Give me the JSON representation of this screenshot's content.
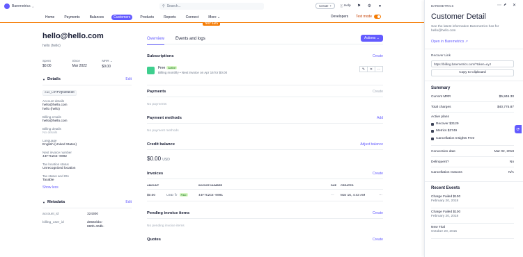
{
  "topbar": {
    "brand": "Baremetrics",
    "search_placeholder": "Search...",
    "create_label": "Create",
    "help_label": "Help"
  },
  "nav": {
    "items": [
      "Home",
      "Payments",
      "Balances",
      "Customers",
      "Products",
      "Reports",
      "Connect",
      "More"
    ],
    "active": "Customers",
    "developers": "Developers",
    "test_mode": "Test mode",
    "test_data_label": "TEST DATA"
  },
  "customer": {
    "email": "hello@hello.com",
    "subtitle": "hello (hello)",
    "stats": [
      {
        "label": "Spent",
        "value": "$0.00"
      },
      {
        "label": "Since",
        "value": "Mar 2022"
      },
      {
        "label": "MRR",
        "value": "$0.00"
      }
    ],
    "details": {
      "title": "Details",
      "edit": "Edit",
      "id": "cus_LKYFYQ5UKNKUD",
      "fields": [
        {
          "label": "Account details",
          "value": "hello@hello.com\nhello (hello)"
        },
        {
          "label": "Billing emails",
          "value": "hello@hello.com"
        },
        {
          "label": "Billing details",
          "value": "No details"
        },
        {
          "label": "Language",
          "value": "English (United States)"
        },
        {
          "label": "Next invoice number",
          "value": "44F7C2C8-0002"
        },
        {
          "label": "Tax location status",
          "value": "Unrecognized location"
        },
        {
          "label": "Tax status and IDs",
          "value": "Taxable"
        }
      ],
      "show_less": "Show less"
    },
    "metadata": {
      "title": "Metadata",
      "edit": "Edit",
      "rows": [
        {
          "key": "account_id",
          "value": "324300"
        },
        {
          "key": "billing_user_id",
          "value": "d056ebbc-\n880b-40db-"
        }
      ]
    }
  },
  "main": {
    "tabs": [
      "Overview",
      "Events and logs"
    ],
    "actions": "Actions",
    "subscriptions": {
      "title": "Subscriptions",
      "create": "Create",
      "plan": "Free",
      "status": "Active",
      "detail": "Billing monthly • Next invoice on Apr 16 for $0.00"
    },
    "payments": {
      "title": "Payments",
      "create": "Create",
      "empty": "No payments"
    },
    "payment_methods": {
      "title": "Payment methods",
      "add": "Add",
      "empty": "No payment methods"
    },
    "credit_balance": {
      "title": "Credit balance",
      "adjust": "Adjust balance",
      "amount": "$0.00",
      "currency": "USD"
    },
    "invoices": {
      "title": "Invoices",
      "create": "Create",
      "headers": [
        "AMOUNT",
        "INVOICE NUMBER",
        "DUE",
        "CREATED"
      ],
      "row": {
        "amount": "$0.00",
        "currency": "USD",
        "status": "Paid",
        "number": "44F7C2C8-0001",
        "due": "—",
        "created": "Mar 16, 4:43 AM"
      }
    },
    "pending_items": {
      "title": "Pending invoice items",
      "create": "Create",
      "empty": "No pending invoice items"
    },
    "quotes": {
      "title": "Quotes",
      "create": "Create"
    }
  },
  "panel": {
    "header": "BAREMETRICS",
    "title": "Customer Detail",
    "desc": "See the latest information Baremetrics has for hello@hello.com",
    "open": "Open in Baremetrics",
    "recover_label": "Recover Link",
    "recover_url": "https://billing.baremetrics.com/?token=eyJ",
    "copy": "Copy to Clipboard",
    "summary_title": "Summary",
    "summary": [
      {
        "label": "Current MRR",
        "value": "$5,846.30"
      },
      {
        "label": "Total charges",
        "value": "$40,775.87"
      }
    ],
    "active_plans_label": "Active plans",
    "plans": [
      "Recover $3129",
      "Metrics $3749",
      "Cancellation Insights Free"
    ],
    "summary2": [
      {
        "label": "Conversion date",
        "value": "Mar 02, 2018"
      },
      {
        "label": "Delinquent?",
        "value": "No"
      },
      {
        "label": "Cancellation reasons",
        "value": "N/A"
      }
    ],
    "events_title": "Recent Events",
    "events": [
      {
        "title": "Charge Failed $100",
        "date": "February 20, 2018"
      },
      {
        "title": "Charge Failed $100",
        "date": "February 20, 2018"
      },
      {
        "title": "New Trial",
        "date": "October 20, 2015"
      }
    ]
  }
}
